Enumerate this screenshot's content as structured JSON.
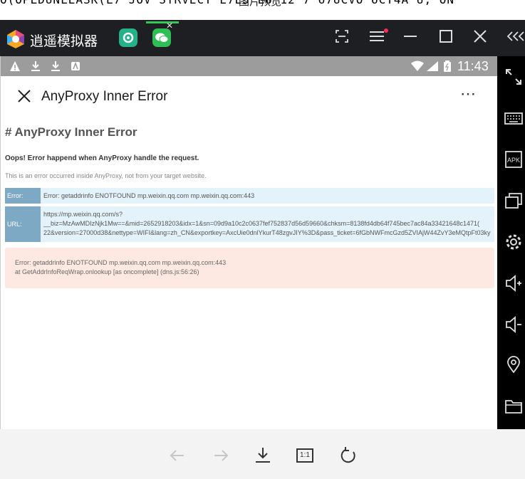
{
  "top_strip": {
    "code_text": "  O(OPLDUNLEASK(L7  JOV  STRVECY  E7E3  L6  12  7  67UCVO  6CT4A  U; ON",
    "caption": "图片预览"
  },
  "emulator": {
    "app_name": "逍遥模拟器",
    "tabs": [
      {
        "icon": "app-tab-icon"
      },
      {
        "icon": "wechat-tab-icon",
        "active": true
      }
    ],
    "colors": {
      "titlebar": "#1e1f22",
      "accent_tab": "#36c75a"
    }
  },
  "status_bar": {
    "time": "11:43"
  },
  "app_bar": {
    "title": "AnyProxy Inner Error"
  },
  "page": {
    "heading": "# AnyProxy Inner Error",
    "oops": "Oops! Error happend when AnyProxy handle the request.",
    "note": "This is an error occurred inside AnyProxy, not from your target website.",
    "error_row": {
      "label": "Error:",
      "value": "Error: getaddrinfo ENOTFOUND mp.weixin.qq.com mp.weixin.qq.com:443"
    },
    "url_row": {
      "label": "URL:",
      "line1": "https://mp.weixin.qq.com/s?",
      "line2": "__biz=MzAwMDIzNjk1Mw==&mid=2652918203&idx=1&sn=09d9a10c2c0637fef752837d56d59660&chksm=8138fd4db64f745bec7ac84a33421648c1471(",
      "line3": "22&version=27000d38&nettype=WIFI&lang=zh_CN&exportkey=AxcUie0dnlYkurT48zgvJIY%3D&pass_ticket=6fGbNWFmcGzd5ZVIAjW44ZvY3eMQtpFt03ky"
    },
    "stack": {
      "line1": "Error: getaddrinfo ENOTFOUND mp.weixin.qq.com mp.weixin.qq.com:443",
      "line2": "at GetAddrInfoReqWrap.onlookup [as oncomplete] (dns.js:56:26)"
    }
  },
  "viewer": {
    "actual_size_label": "1:1"
  }
}
